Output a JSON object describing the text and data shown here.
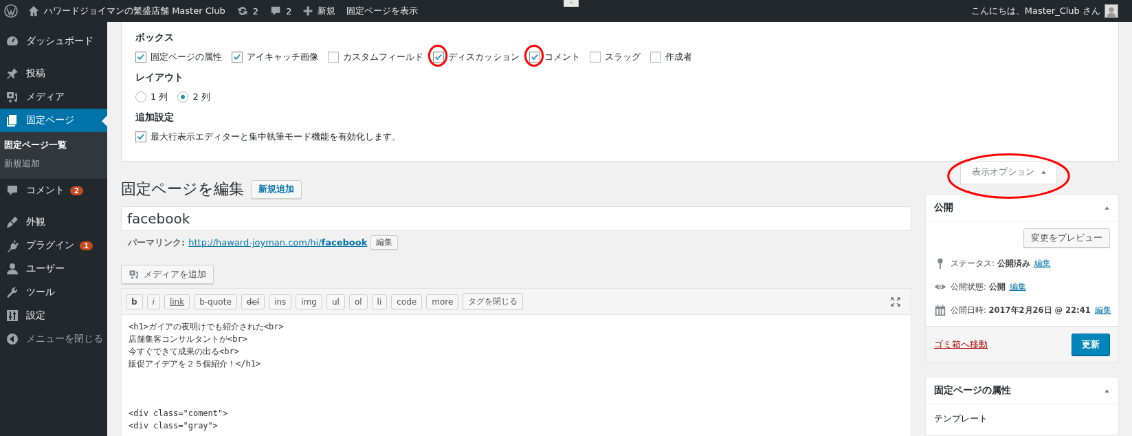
{
  "admin_bar": {
    "site_name": "ハワードジョイマンの繁盛店舗 Master Club",
    "updates": "2",
    "comments": "2",
    "new_label": "新規",
    "view_page": "固定ページを表示",
    "greeting": "こんにちは、Master_Club さん"
  },
  "sidebar": {
    "items": [
      {
        "kind": "dashboard",
        "label": "ダッシュボード",
        "selected": false
      },
      {
        "kind": "posts",
        "label": "投稿",
        "selected": false
      },
      {
        "kind": "media",
        "label": "メディア",
        "selected": false
      },
      {
        "kind": "pages",
        "label": "固定ページ",
        "selected": true,
        "children": [
          {
            "label": "固定ページ一覧",
            "selected": true
          },
          {
            "label": "新規追加",
            "selected": false
          }
        ]
      },
      {
        "kind": "comments",
        "label": "コメント",
        "selected": false,
        "badge": "2"
      },
      {
        "kind": "appearance",
        "label": "外観",
        "selected": false
      },
      {
        "kind": "plugins",
        "label": "プラグイン",
        "selected": false,
        "badge": "1"
      },
      {
        "kind": "users",
        "label": "ユーザー",
        "selected": false
      },
      {
        "kind": "tools",
        "label": "ツール",
        "selected": false
      },
      {
        "kind": "settings",
        "label": "設定",
        "selected": false
      },
      {
        "kind": "collapse",
        "label": "メニューを閉じる",
        "selected": false
      }
    ]
  },
  "screen_options": {
    "sections": [
      {
        "kind": "checkboxes",
        "title": "ボックス",
        "options": [
          {
            "label": "固定ページの属性",
            "checked": true
          },
          {
            "label": "アイキャッチ画像",
            "checked": true
          },
          {
            "label": "カスタムフィールド",
            "checked": false
          },
          {
            "label": "ディスカッション",
            "checked": true,
            "circled": true
          },
          {
            "label": "コメント",
            "checked": true,
            "circled": true
          },
          {
            "label": "スラッグ",
            "checked": false
          },
          {
            "label": "作成者",
            "checked": false
          }
        ]
      },
      {
        "kind": "radios",
        "title": "レイアウト",
        "options": [
          {
            "label": "1 列",
            "selected": false
          },
          {
            "label": "2 列",
            "selected": true
          }
        ]
      },
      {
        "kind": "checkboxes",
        "title": "追加設定",
        "options": [
          {
            "label": "最大行表示エディターと集中執筆モード機能を有効化します。",
            "checked": true
          }
        ]
      }
    ],
    "toggle": {
      "label": "表示オプション",
      "circled": true
    }
  },
  "heading": {
    "title": "固定ページを編集",
    "add_new": "新規追加"
  },
  "title_field": {
    "value": "facebook"
  },
  "permalink": {
    "label": "パーマリンク:",
    "url": "http://haward-joyman.com/hi/**facebook**",
    "edit": "編集"
  },
  "add_media": "メディアを追加",
  "quicktags": [
    {
      "label": "b",
      "kind": "bold"
    },
    {
      "label": "i",
      "kind": "italic"
    },
    {
      "label": "link",
      "kind": "underline"
    },
    {
      "label": "b-quote",
      "kind": "plain"
    },
    {
      "label": "del",
      "kind": "strike"
    },
    {
      "label": "ins",
      "kind": "plain"
    },
    {
      "label": "img",
      "kind": "plain"
    },
    {
      "label": "ul",
      "kind": "plain"
    },
    {
      "label": "ol",
      "kind": "plain"
    },
    {
      "label": "li",
      "kind": "plain"
    },
    {
      "label": "code",
      "kind": "plain"
    },
    {
      "label": "more",
      "kind": "plain"
    },
    {
      "label": "タグを閉じる",
      "kind": "plain"
    }
  ],
  "editor": {
    "value": "<h1>ガイアの夜明けでも紹介された<br>\n店舗集客コンサルタントが<br>\n今すぐできて成果の出る<br>\n販促アイデアを２５個紹介！</h1>\n\n\n\n<div class=\"coment\">\n<div class=\"gray\">"
  },
  "publish_box": {
    "title": "公開",
    "preview": "変更をプレビュー",
    "rows": [
      {
        "kind": "status",
        "text": "ステータス: **公開済み**",
        "link": "編集"
      },
      {
        "kind": "visibility",
        "text": "公開状態: **公開**",
        "link": "編集"
      },
      {
        "kind": "date",
        "text": "公開日時: **2017年2月26日 @ 22:41**",
        "link": "編集"
      }
    ],
    "trash": "ゴミ箱へ移動",
    "update": "更新"
  },
  "attributes_box": {
    "title": "固定ページの属性",
    "template_label": "テンプレート"
  }
}
